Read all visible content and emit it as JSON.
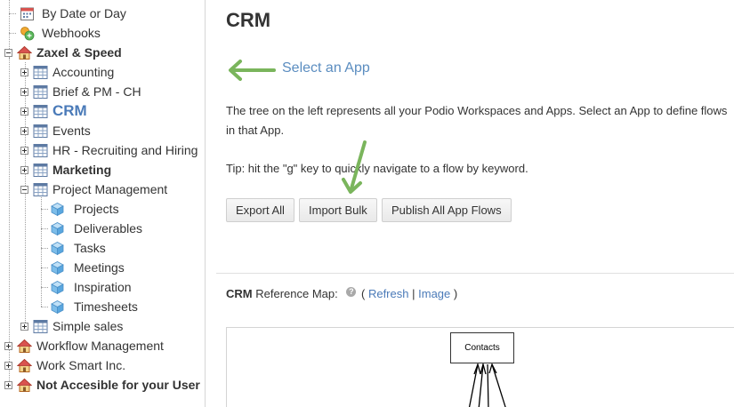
{
  "tree": {
    "items": [
      {
        "label": "By Date or Day",
        "icon": "calendar-icon"
      },
      {
        "label": "Webhooks",
        "icon": "webhook-icon"
      },
      {
        "label": "Zaxel & Speed",
        "icon": "house-icon"
      },
      {
        "label": "Accounting",
        "icon": "app-grid-icon"
      },
      {
        "label": "Brief & PM - CH",
        "icon": "app-grid-icon"
      },
      {
        "label": "CRM",
        "icon": "app-grid-icon"
      },
      {
        "label": "Events",
        "icon": "app-grid-icon"
      },
      {
        "label": "HR - Recruiting and Hiring",
        "icon": "app-grid-icon"
      },
      {
        "label": "Marketing",
        "icon": "app-grid-icon"
      },
      {
        "label": "Project Management",
        "icon": "app-grid-icon"
      },
      {
        "label": "Projects",
        "icon": "cube-icon"
      },
      {
        "label": "Deliverables",
        "icon": "cube-icon"
      },
      {
        "label": "Tasks",
        "icon": "cube-icon"
      },
      {
        "label": "Meetings",
        "icon": "cube-icon"
      },
      {
        "label": "Inspiration",
        "icon": "cube-icon"
      },
      {
        "label": "Timesheets",
        "icon": "cube-icon"
      },
      {
        "label": "Simple sales",
        "icon": "app-grid-icon"
      },
      {
        "label": "Workflow Management",
        "icon": "house-icon"
      },
      {
        "label": "Work Smart Inc.",
        "icon": "house-icon"
      },
      {
        "label": "Not Accesible for your User",
        "icon": "house-icon"
      }
    ]
  },
  "main": {
    "title": "CRM",
    "select_prompt": "Select an App",
    "description": "The tree on the left represents all your Podio Workspaces and Apps. Select an App to define flows in that App.",
    "tip": "Tip: hit the \"g\" key to quickly navigate to a flow by keyword.",
    "buttons": {
      "export_all": "Export All",
      "import_bulk": "Import Bulk",
      "publish_all": "Publish All App Flows"
    },
    "reference_map": {
      "app_name": "CRM",
      "label": "Reference Map:",
      "open_paren": "(",
      "refresh": "Refresh",
      "separator": "|",
      "image": "Image",
      "close_paren": ")",
      "help_glyph": "?"
    },
    "map_nodes": {
      "contacts": "Contacts"
    }
  },
  "colors": {
    "accent_link": "#4a7ab8",
    "select_prompt": "#5b8dc0",
    "arrow_green": "#7ab55c"
  }
}
